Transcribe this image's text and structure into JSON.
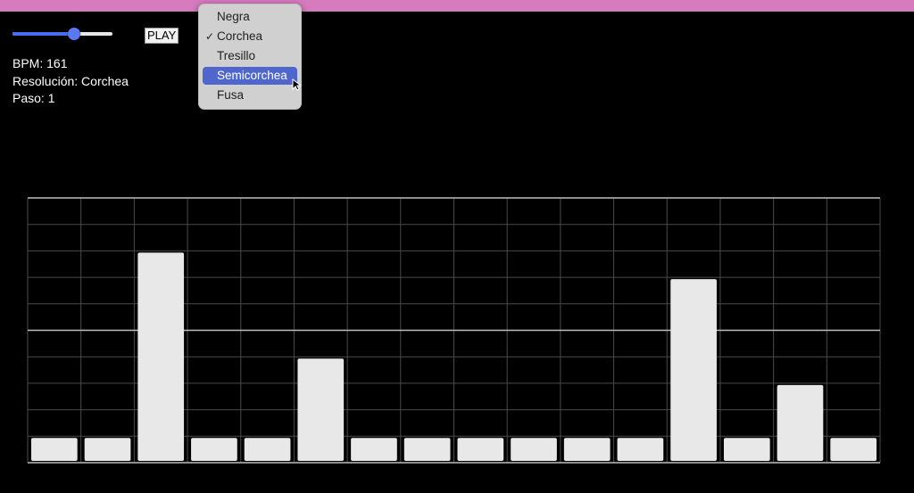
{
  "colors": {
    "top_bar": "#d77bbf",
    "slider_fill": "#4b6cf0",
    "dropdown_highlight": "#4f66cc",
    "bar": "#e8e8e8"
  },
  "controls": {
    "tempo_slider_level": 0.62,
    "play_label": "PLAY"
  },
  "info": {
    "bpm": "BPM: 161",
    "resolution": "Resolución: Corchea",
    "step": "Paso: 1"
  },
  "dropdown": {
    "options": [
      {
        "label": "Negra",
        "checked": false,
        "highlighted": false
      },
      {
        "label": "Corchea",
        "checked": true,
        "highlighted": false
      },
      {
        "label": "Tresillo",
        "checked": false,
        "highlighted": false
      },
      {
        "label": "Semicorchea",
        "checked": false,
        "highlighted": true
      },
      {
        "label": "Fusa",
        "checked": false,
        "highlighted": false
      }
    ],
    "check_glyph": "✓"
  },
  "sequencer": {
    "steps": 16,
    "rows": 10,
    "values": [
      1,
      1,
      8,
      1,
      1,
      4,
      1,
      1,
      1,
      1,
      1,
      1,
      7,
      1,
      3,
      1
    ]
  }
}
